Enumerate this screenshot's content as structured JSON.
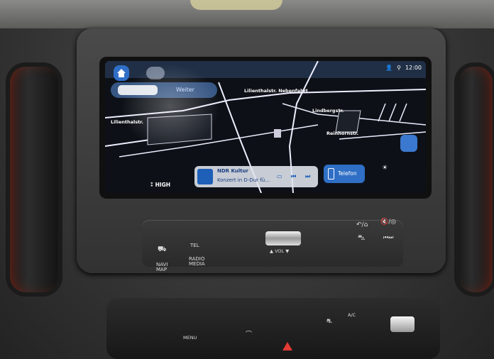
{
  "screen": {
    "destination_text": "Weiter",
    "status_time": "12:00",
    "streets": [
      "Lilienthalstr.",
      "Lindbergstr.",
      "Reinhornstr.",
      "Lilienthalstr. Nebenfahrt"
    ],
    "fan_speed": "HIGH",
    "media": {
      "station": "NDR Kultur",
      "track": "Konzert in D-Dur fü..."
    },
    "phone_label": "Telefon"
  },
  "panel": {
    "nav_label": "NAVI MAP",
    "tel_label": "TEL",
    "radio_label": "RADIO MEDIA",
    "vol_label": "VOL"
  },
  "lower": {
    "menu_label": "MENU",
    "ac_label": "A/C"
  },
  "colors": {
    "accent": "#2f6fc6",
    "hazard": "#e23a35"
  }
}
